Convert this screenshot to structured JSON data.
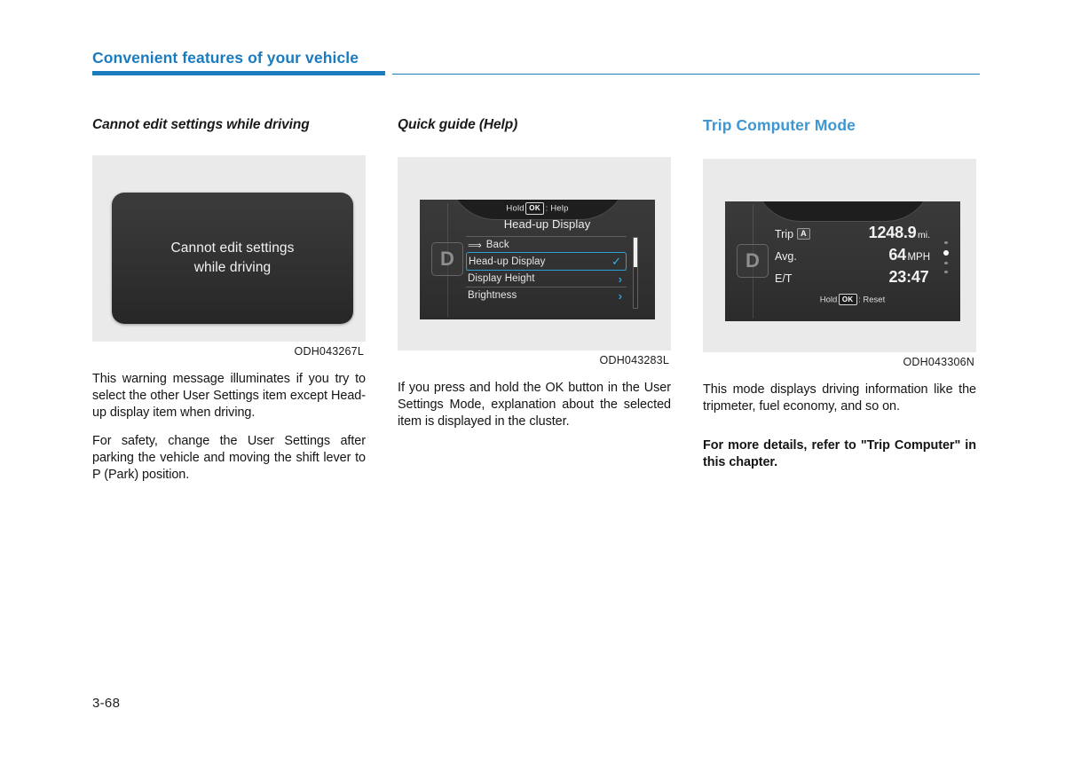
{
  "header": {
    "chapter_title": "Convenient features of your vehicle",
    "accent_color": "#1a7bbf"
  },
  "page_number": "3-68",
  "columns": {
    "left": {
      "heading": "Cannot edit settings while driving",
      "figure": {
        "caption": "ODH043267L",
        "popup_line1": "Cannot edit settings",
        "popup_line2": "while driving"
      },
      "paragraphs": [
        "This warning message illuminates if you try to select the other User Settings item except Head-up display item when driving.",
        "For safety, change the User Settings after parking the vehicle and moving the shift lever to P (Park) position."
      ]
    },
    "middle": {
      "heading": "Quick guide (Help)",
      "figure": {
        "caption": "ODH043283L",
        "hint_prefix": "Hold",
        "hint_key": "OK",
        "hint_suffix": ": Help",
        "screen_title": "Head-up Display",
        "gear_indicator": "D",
        "menu_items": [
          {
            "label": "Back",
            "icon": "back-arrow-icon",
            "control": "none",
            "selected": false
          },
          {
            "label": "Head-up Display",
            "icon": "none",
            "control": "check",
            "selected": true
          },
          {
            "label": "Display Height",
            "icon": "none",
            "control": "chevron",
            "selected": false
          },
          {
            "label": "Brightness",
            "icon": "none",
            "control": "chevron",
            "selected": false
          }
        ]
      },
      "paragraphs": [
        "If you press and hold the OK button in the User Settings Mode, explanation about the selected item is displayed in the cluster."
      ]
    },
    "right": {
      "heading": "Trip Computer Mode",
      "heading_color": "#3e96d2",
      "figure": {
        "caption": "ODH043306N",
        "gear_indicator": "D",
        "rows": [
          {
            "label": "Trip",
            "badge": "A",
            "value": "1248.9",
            "unit": "mi."
          },
          {
            "label": "Avg.",
            "badge": "",
            "value": "64",
            "unit": "MPH"
          },
          {
            "label": "E/T",
            "badge": "",
            "value": "23:47",
            "unit": ""
          }
        ],
        "hint_prefix": "Hold",
        "hint_key": "OK",
        "hint_suffix": ": Reset",
        "page_dots_total": 4,
        "page_dots_active_index": 1
      },
      "paragraphs": [
        "This mode displays driving information like the tripmeter, fuel economy, and so on."
      ],
      "bold_paragraph": "For more details, refer to \"Trip Computer\" in this chapter."
    }
  }
}
